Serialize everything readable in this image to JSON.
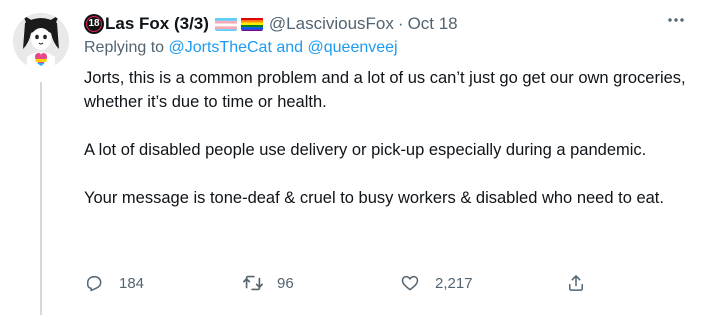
{
  "tweet": {
    "display_name": "Las Fox (3/3)",
    "age_badge": "18",
    "handle": "@LasciviousFox",
    "separator": "·",
    "date": "Oct 18",
    "replying_prefix": "Replying to",
    "replying_to_1": "@JortsTheCat",
    "replying_and": "and",
    "replying_to_2": "@queenveej",
    "paragraphs": [
      "Jorts, this is a common problem and a lot of us can’t just go get our own groceries, whether it’s due to time or health.",
      "A lot of disabled people use delivery or pick-up especially during a pandemic.",
      "Your message is tone-deaf & cruel to busy workers & disabled who need to eat."
    ],
    "actions": {
      "reply_count": "184",
      "retweet_count": "96",
      "like_count": "2,217"
    }
  },
  "icons": {
    "avatar": "avatar-illustration",
    "flag_1": "trans-flag-icon",
    "flag_2": "rainbow-flag-icon",
    "more": "more-icon",
    "reply": "reply-icon",
    "retweet": "retweet-icon",
    "like": "heart-icon",
    "share": "share-icon"
  },
  "colors": {
    "link": "#1d9bf0",
    "secondary_text": "#536471",
    "primary_text": "#0f1419"
  }
}
